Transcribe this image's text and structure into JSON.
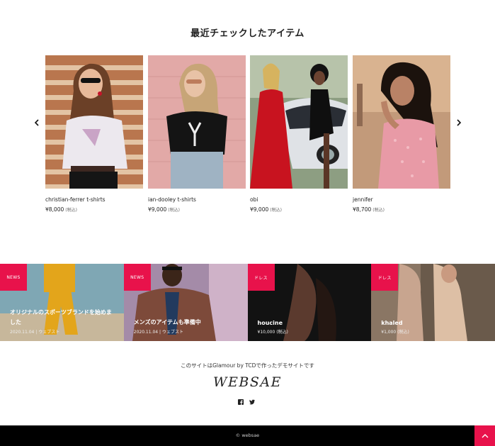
{
  "recent": {
    "title": "最近チェックしたアイテム",
    "items": [
      {
        "name": "christian-ferrer t-shirts",
        "price": "¥8,000",
        "tax": "(税込)"
      },
      {
        "name": "ian-dooley t-shirts",
        "price": "¥9,000",
        "tax": "(税込)"
      },
      {
        "name": "obi",
        "price": "¥9,000",
        "tax": "(税込)"
      },
      {
        "name": "jennifer",
        "price": "¥8,700",
        "tax": "(税込)"
      }
    ],
    "prev_icon": "chevron-left-icon",
    "next_icon": "chevron-right-icon"
  },
  "banners": [
    {
      "tag": "NEWS",
      "title_line1": "オリジナルのスポーツブランドを始めま",
      "title_line2": "した",
      "meta": "2020.11.04 | ウェブスト"
    },
    {
      "tag": "NEWS",
      "title_line1": "メンズのアイテムも準備中",
      "title_line2": "",
      "meta": "2020.11.04 | ウェブスト"
    },
    {
      "tag": "ドレス",
      "title_line1": "houcine",
      "title_line2": "",
      "meta": "¥10,000 (税込)"
    },
    {
      "tag": "ドレス",
      "title_line1": "khaled",
      "title_line2": "",
      "meta": "¥1,000 (税込)"
    }
  ],
  "footer": {
    "credit": "このサイトはGlamour by TCDで作ったデモサイトです",
    "logo": "WEBSAE",
    "social": [
      "facebook-icon",
      "twitter-icon"
    ],
    "copyright": "© websae",
    "totop_icon": "chevron-up-icon"
  },
  "colors": {
    "accent": "#e8124b",
    "footer_bg": "#000000"
  }
}
